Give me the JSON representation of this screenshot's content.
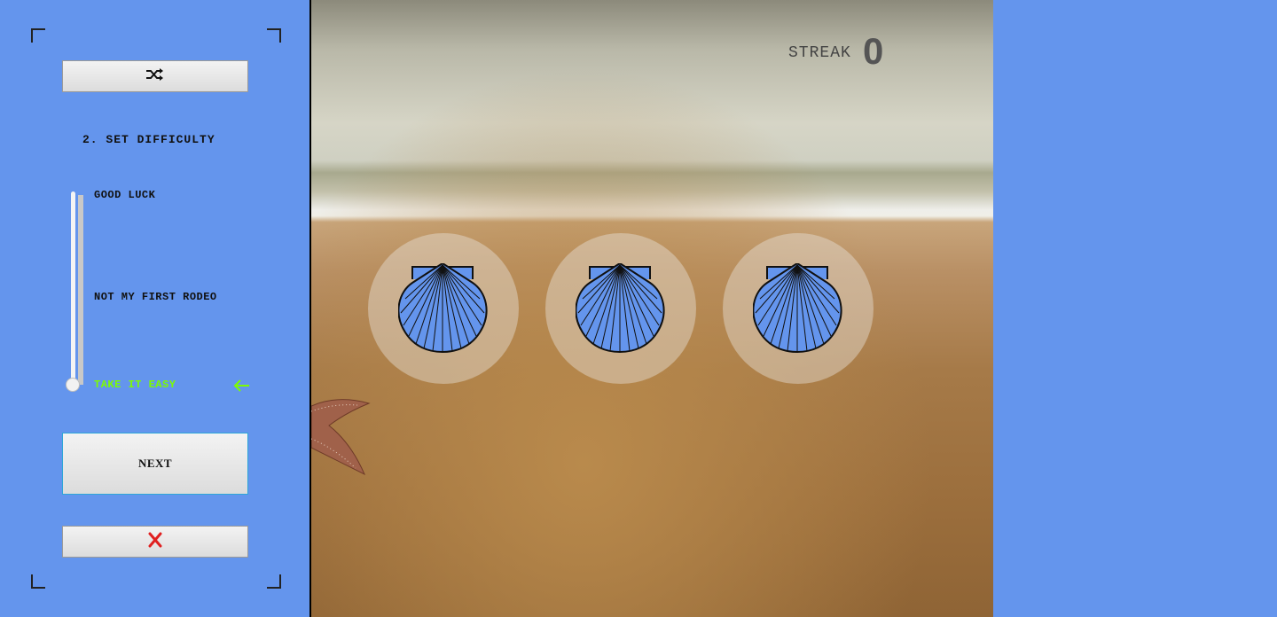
{
  "sidebar": {
    "step_title": "2. SET DIFFICULTY",
    "shuffle_icon": "shuffle-icon",
    "levels": [
      "GOOD LUCK",
      "NOT MY FIRST RODEO",
      "TAKE IT EASY"
    ],
    "selected_level_index": 2,
    "selected_color": "#7cfc00",
    "next_label": "NEXT",
    "close_icon": "close-x-icon",
    "close_color": "#e02020"
  },
  "game": {
    "streak_label": "STREAK",
    "streak_value": "0",
    "shell_count": 3,
    "shell_color": "#6495ed"
  },
  "colors": {
    "background": "#6495ed",
    "accent": "#7cfc00"
  }
}
